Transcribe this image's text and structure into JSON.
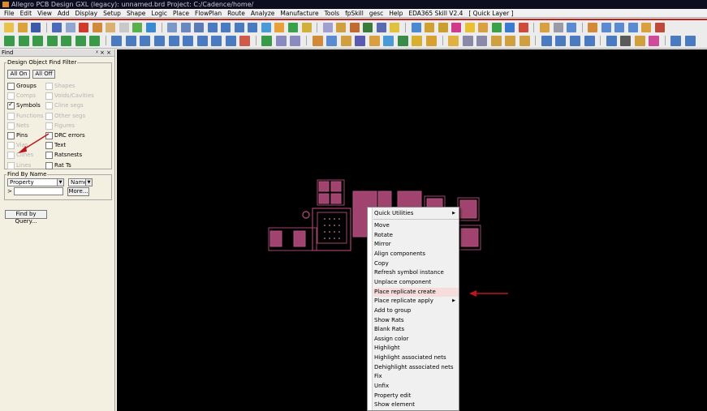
{
  "window": {
    "title": "Allegro PCB Design GXL (legacy): unnamed.brd  Project: C:/Cadence/home/"
  },
  "menubar": {
    "items": [
      "File",
      "Edit",
      "View",
      "Add",
      "Display",
      "Setup",
      "Shape",
      "Logic",
      "Place",
      "FlowPlan",
      "Route",
      "Analyze",
      "Manufacture",
      "Tools",
      "fpSkill",
      "gesc",
      "Help",
      "EDA365 Skill V2.4",
      "[ Quick Layer ]"
    ]
  },
  "find_panel": {
    "header": "Find",
    "header_controls": "ᵡ × ×",
    "object_filter": {
      "legend": "Design Object Find Filter",
      "all_on": "All On",
      "all_off": "All Off",
      "items": [
        {
          "label": "Groups",
          "checked": false,
          "enabled": true
        },
        {
          "label": "Shapes",
          "checked": false,
          "enabled": false
        },
        {
          "label": "Comps",
          "checked": false,
          "enabled": false
        },
        {
          "label": "Voids/Cavities",
          "checked": false,
          "enabled": false
        },
        {
          "label": "Symbols",
          "checked": true,
          "enabled": true
        },
        {
          "label": "Cline segs",
          "checked": false,
          "enabled": false
        },
        {
          "label": "Functions",
          "checked": false,
          "enabled": false
        },
        {
          "label": "Other segs",
          "checked": false,
          "enabled": false
        },
        {
          "label": "Nets",
          "checked": false,
          "enabled": false
        },
        {
          "label": "Figures",
          "checked": false,
          "enabled": false
        },
        {
          "label": "Pins",
          "checked": false,
          "enabled": true
        },
        {
          "label": "DRC errors",
          "checked": false,
          "enabled": true
        },
        {
          "label": "Vias",
          "checked": false,
          "enabled": false
        },
        {
          "label": "Text",
          "checked": false,
          "enabled": true
        },
        {
          "label": "Clines",
          "checked": false,
          "enabled": false
        },
        {
          "label": "Ratsnests",
          "checked": false,
          "enabled": true
        },
        {
          "label": "Lines",
          "checked": false,
          "enabled": false
        },
        {
          "label": "Rat Ts",
          "checked": false,
          "enabled": true
        }
      ]
    },
    "find_by_name": {
      "legend": "Find By Name",
      "type_value": "Property",
      "mode_value": "Name",
      "prefix": ">",
      "input_value": "",
      "more_label": "More..."
    },
    "find_by_query_label": "Find by Query..."
  },
  "context_menu": {
    "header": "Quick Utilities",
    "items": [
      {
        "label": "Move"
      },
      {
        "label": "Rotate"
      },
      {
        "label": "Mirror"
      },
      {
        "label": "Align components"
      },
      {
        "label": "Copy"
      },
      {
        "label": "Refresh symbol instance"
      },
      {
        "label": "Unplace component"
      },
      {
        "label": "Place replicate create",
        "highlighted": true
      },
      {
        "label": "Place replicate apply",
        "submenu": true
      },
      {
        "label": "Add to group"
      },
      {
        "label": "Show Rats"
      },
      {
        "label": "Blank Rats"
      },
      {
        "label": "Assign color"
      },
      {
        "label": "Highlight"
      },
      {
        "label": "Highlight associated nets"
      },
      {
        "label": "Dehighlight associated nets"
      },
      {
        "label": "Fix"
      },
      {
        "label": "Unfix"
      },
      {
        "label": "Property edit"
      },
      {
        "label": "Show element"
      }
    ]
  },
  "colors": {
    "canvas_bg": "#000000",
    "component": "#a0446f",
    "component_outline": "#b1517e",
    "pad_text": "#ff9ad0",
    "annotation_arrow": "#c0141a",
    "menu_highlight": "#f7dcdc"
  },
  "toolbar_icons": [
    "new-file-icon",
    "open-icon",
    "save-icon",
    "move-icon",
    "copy-icon",
    "delete-icon",
    "undo-icon",
    "redo-icon",
    "pin-icon",
    "grid-icon",
    "zoom-in-icon",
    "zoom-out-icon",
    "zoom-fit-icon",
    "redraw-icon",
    "3d-view-icon",
    "layer-icon",
    "drc-icon"
  ]
}
